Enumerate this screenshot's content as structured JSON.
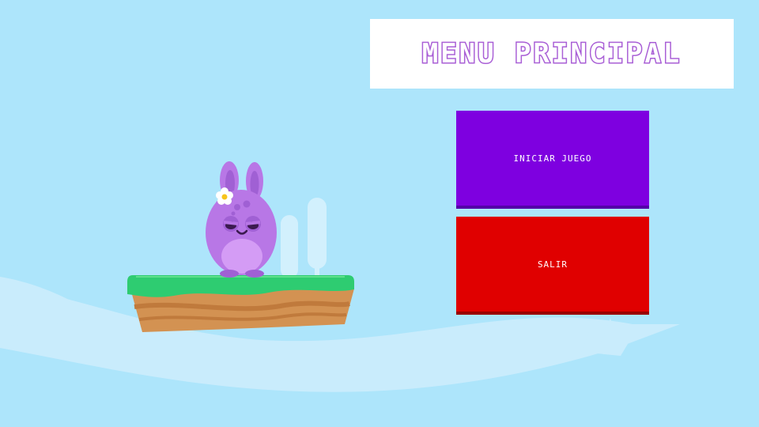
{
  "menu": {
    "title": "MENU PRINCIPAL",
    "start_label": "INICIAR JUEGO",
    "exit_label": "SALIR"
  },
  "colors": {
    "sky": "#ade5fb",
    "title_text": "#a95fd6",
    "start_button": "#7e00e0",
    "exit_button": "#e00000",
    "grass": "#2ecc71",
    "dirt": "#d39252",
    "character": "#b877e6"
  },
  "scene": {
    "character": "purple-bunny-character",
    "character_accessory": "flower-icon",
    "platform": "floating-grass-platform"
  }
}
